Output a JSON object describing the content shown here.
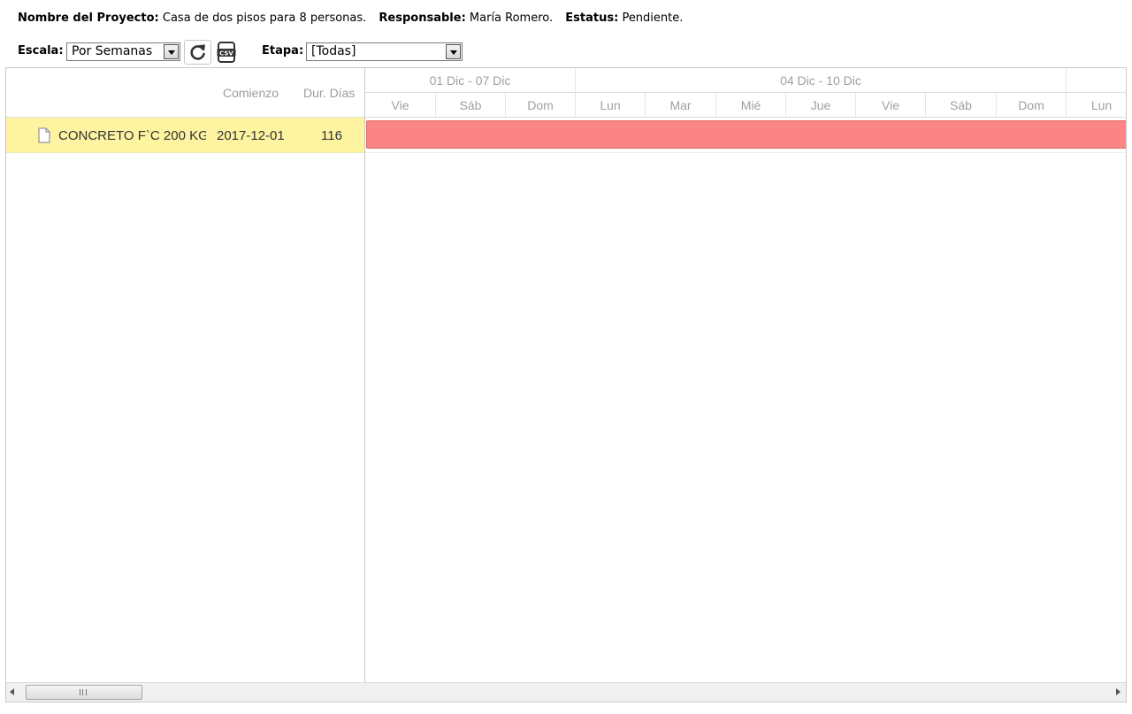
{
  "project": {
    "name_label": "Nombre del Proyecto:",
    "name_value": "Casa de dos pisos para 8 personas.",
    "responsible_label": "Responsable:",
    "responsible_value": "María Romero.",
    "status_label": "Estatus:",
    "status_value": "Pendiente."
  },
  "toolbar": {
    "scale_label": "Escala:",
    "scale_value": "Por Semanas",
    "refresh_icon": "refresh-icon",
    "csv_icon": "csv-export-icon",
    "csv_text": "CSV",
    "stage_label": "Etapa:",
    "stage_value": "[Todas]"
  },
  "grid": {
    "columns": [
      "Comienzo",
      "Dur. Días"
    ],
    "rows": [
      {
        "name": "CONCRETO F`C 200 KG",
        "start": "2017-12-01",
        "duration": "116",
        "icon": "file-icon"
      }
    ]
  },
  "timeline": {
    "weeks": [
      "01 Dic - 07 Dic",
      "04 Dic - 10 Dic"
    ],
    "days": [
      "Vie",
      "Sáb",
      "Dom",
      "Lun",
      "Mar",
      "Mié",
      "Jue",
      "Vie",
      "Sáb",
      "Dom",
      "Lun"
    ]
  },
  "colors": {
    "selected_row": "#fdf3a0",
    "task_bar": "#fb8585"
  }
}
